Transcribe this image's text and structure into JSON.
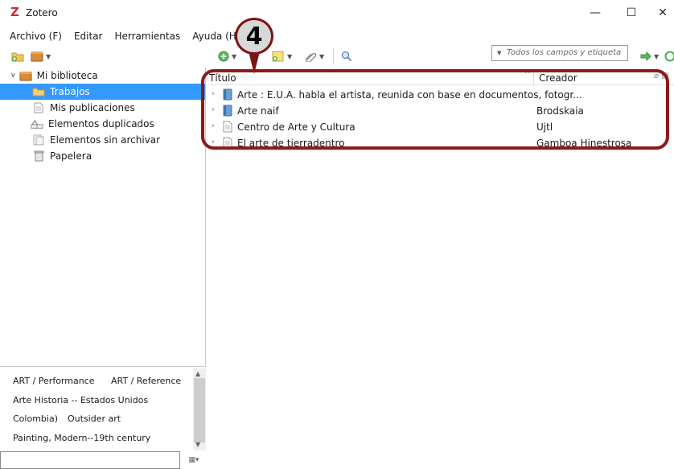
{
  "window": {
    "title": "Zotero",
    "logo_letter": "Z",
    "minimize_glyph": "—",
    "maximize_glyph": "☐",
    "close_glyph": "✕"
  },
  "menu": {
    "items": [
      "Archivo (F)",
      "Editar",
      "Herramientas",
      "Ayuda (H)"
    ]
  },
  "toolbar": {
    "search_placeholder": "Todos los campos y etiqueta",
    "search_mode_caret": "▼",
    "icons": [
      "new-collection-icon",
      "new-library-icon",
      "new-item-icon",
      "new-note-icon",
      "add-attachment-icon",
      "advanced-search-icon",
      "locate-icon",
      "sync-icon"
    ]
  },
  "collections": {
    "root": "Mi biblioteca",
    "items": [
      {
        "label": "Trabajos",
        "icon": "folder-icon",
        "selected": true
      },
      {
        "label": "Mis publicaciones",
        "icon": "publications-icon"
      },
      {
        "label": "Elementos duplicados",
        "icon": "duplicates-icon"
      },
      {
        "label": "Elementos sin archivar",
        "icon": "unfiled-icon"
      },
      {
        "label": "Papelera",
        "icon": "trash-icon"
      }
    ]
  },
  "tags": {
    "lines": [
      [
        "ART / Performance",
        "ART / Reference"
      ],
      [
        "Arte Historia -- Estados Unidos"
      ],
      [
        "Colombia)",
        "Outsider art"
      ],
      [
        "Painting, Modern--19th century"
      ]
    ]
  },
  "items_table": {
    "columns": {
      "title": "Título",
      "creator": "Creador"
    },
    "rows": [
      {
        "title": "Arte : E.U.A. habla el artista, reunida con base en documentos, fotogr...",
        "creator": "",
        "type": "book"
      },
      {
        "title": "Arte naif",
        "creator": "Brodskaia",
        "type": "book"
      },
      {
        "title": "Centro de Arte y Cultura",
        "creator": "Ujtl",
        "type": "document"
      },
      {
        "title": "El arte de tierradentro",
        "creator": "Gamboa Hinestrosa",
        "type": "document"
      }
    ]
  },
  "annotation": {
    "badge_number": "4",
    "color": "#8b1b1b"
  },
  "colors": {
    "selection": "#3399ff",
    "brand": "#cc2936"
  }
}
